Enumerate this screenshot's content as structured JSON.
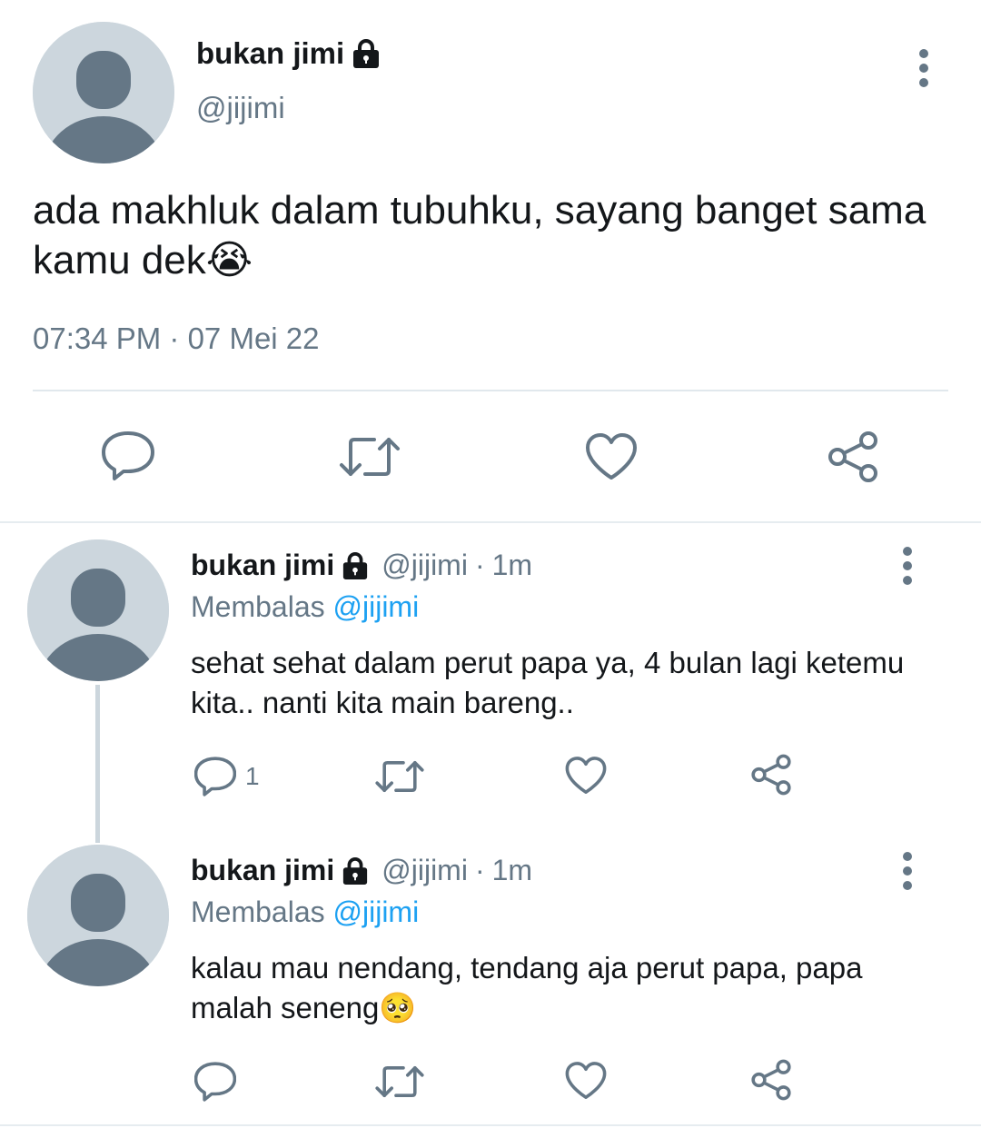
{
  "main_tweet": {
    "name": "bukan jimi",
    "handle": "@jijimi",
    "text": "ada makhluk dalam tubuhku, sayang banget sama kamu dek😭",
    "time": "07:34 PM",
    "date": "07 Mei 22",
    "meta_separator": " · "
  },
  "replies": [
    {
      "name": "bukan jimi",
      "handle": "@jijimi",
      "time": "1m",
      "replying_prefix": "Membalas ",
      "replying_to": "@jijimi",
      "text": "sehat sehat dalam perut papa ya, 4 bulan lagi ketemu kita.. nanti kita main bareng..",
      "reply_count": "1"
    },
    {
      "name": "bukan jimi",
      "handle": "@jijimi",
      "time": "1m",
      "replying_prefix": "Membalas ",
      "replying_to": "@jijimi",
      "text": "kalau mau nendang, tendang aja perut papa, papa malah seneng🥺",
      "reply_count": ""
    }
  ],
  "separator_dot": "·",
  "icons": {
    "reply": "reply-bubble-icon",
    "retweet": "retweet-icon",
    "like": "heart-icon",
    "share": "share-icon",
    "more": "more-vertical-icon",
    "lock": "lock-icon",
    "avatar": "default-avatar-icon"
  },
  "colors": {
    "primary_text": "#14171a",
    "secondary_text": "#657786",
    "link": "#1da1f2",
    "divider": "#e1e8ed",
    "avatar_bg": "#ccd6dd",
    "avatar_fg": "#657786"
  }
}
